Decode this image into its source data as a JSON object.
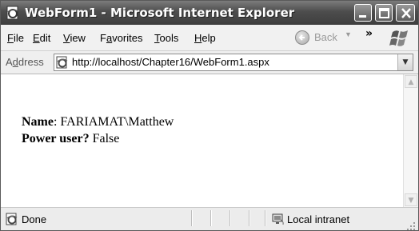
{
  "window": {
    "title": "WebForm1 - Microsoft Internet Explorer"
  },
  "menu": {
    "items": [
      {
        "label": "File",
        "accel": "F",
        "rest": "ile"
      },
      {
        "label": "Edit",
        "accel": "E",
        "rest": "dit"
      },
      {
        "label": "View",
        "accel": "V",
        "rest": "iew"
      },
      {
        "label": "Favorites",
        "pre": "F",
        "accel": "a",
        "rest": "vorites"
      },
      {
        "label": "Tools",
        "accel": "T",
        "rest": "ools"
      },
      {
        "label": "Help",
        "accel": "H",
        "rest": "elp"
      }
    ],
    "back_label": "Back",
    "overflow_glyph": "»"
  },
  "address": {
    "label_accel": "d",
    "label": "Address",
    "url": "http://localhost/Chapter16/WebForm1.aspx"
  },
  "page": {
    "name_label": "Name",
    "name_value": ": FARIAMAT\\Matthew",
    "power_label": "Power user?",
    "power_value": " False"
  },
  "status": {
    "text": "Done",
    "zone": "Local intranet"
  },
  "icons": {
    "title": "ie-page-icon",
    "address": "ie-page-icon",
    "status": "ie-page-icon",
    "zone": "local-intranet-icon",
    "back": "back-arrow-icon",
    "logo": "windows-logo-icon"
  }
}
